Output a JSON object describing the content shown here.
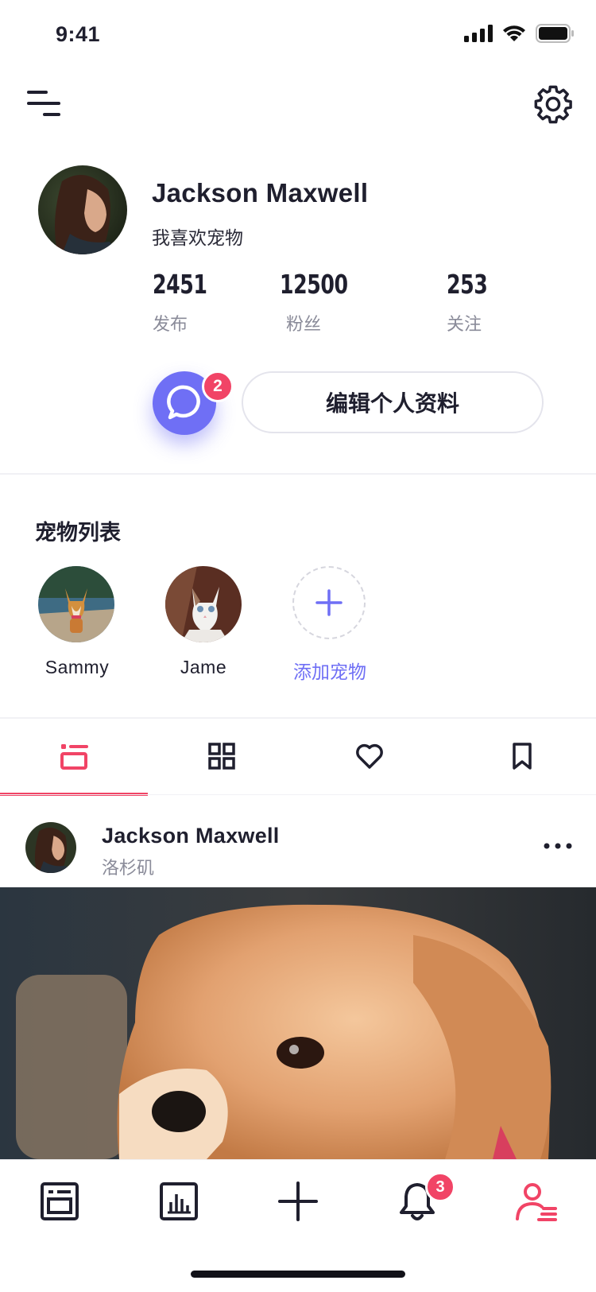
{
  "status_bar": {
    "time": "9:41"
  },
  "profile": {
    "name": "Jackson Maxwell",
    "bio": "我喜欢宠物",
    "stats": [
      {
        "value": "2451",
        "label": "发布"
      },
      {
        "value": "12500",
        "label": "粉丝"
      },
      {
        "value": "253",
        "label": "关注"
      }
    ],
    "message_badge": "2",
    "edit_label": "编辑个人资料"
  },
  "pets": {
    "title": "宠物列表",
    "items": [
      {
        "name": "Sammy"
      },
      {
        "name": "Jame"
      }
    ],
    "add_label": "添加宠物"
  },
  "tabs": {
    "active_index": 0,
    "items": [
      {
        "icon": "list-icon"
      },
      {
        "icon": "grid-icon"
      },
      {
        "icon": "heart-icon"
      },
      {
        "icon": "bookmark-icon"
      }
    ]
  },
  "post": {
    "author": "Jackson Maxwell",
    "location": "洛杉矶"
  },
  "bottom_nav": {
    "active_index": 4,
    "notification_badge": "3",
    "items": [
      {
        "icon": "feed-icon"
      },
      {
        "icon": "stats-icon"
      },
      {
        "icon": "plus-icon"
      },
      {
        "icon": "bell-icon"
      },
      {
        "icon": "profile-icon"
      }
    ]
  },
  "colors": {
    "accent_pink": "#f14466",
    "accent_purple": "#6f6ff5",
    "text_primary": "#1f1f2e",
    "text_secondary": "#8a8b99"
  }
}
